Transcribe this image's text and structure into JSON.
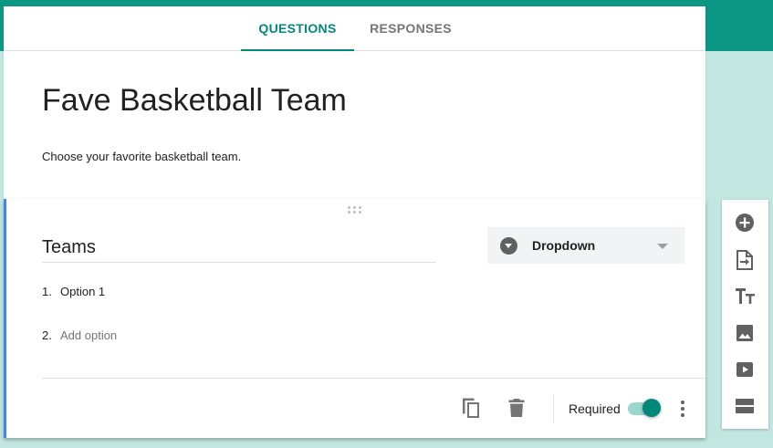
{
  "tabs": [
    {
      "label": "QUESTIONS",
      "active": true
    },
    {
      "label": "RESPONSES",
      "active": false
    }
  ],
  "form": {
    "title": "Fave Basketball Team",
    "description": "Choose your favorite basketball team."
  },
  "question": {
    "title": "Teams",
    "type_label": "Dropdown",
    "options": [
      {
        "number": "1.",
        "label": "Option 1"
      }
    ],
    "add_option": {
      "number": "2.",
      "label": "Add option"
    },
    "required_label": "Required",
    "required": true
  },
  "icons": {
    "footer": [
      "duplicate-icon",
      "delete-icon",
      "more-vert-icon"
    ],
    "toolbar": [
      "add-question-icon",
      "import-questions-icon",
      "add-title-icon",
      "add-image-icon",
      "add-video-icon",
      "add-section-icon"
    ]
  },
  "colors": {
    "brand": "#0b9784",
    "accent": "#00897b",
    "background": "#c2e7e1",
    "active_card_border": "#4285f4"
  }
}
